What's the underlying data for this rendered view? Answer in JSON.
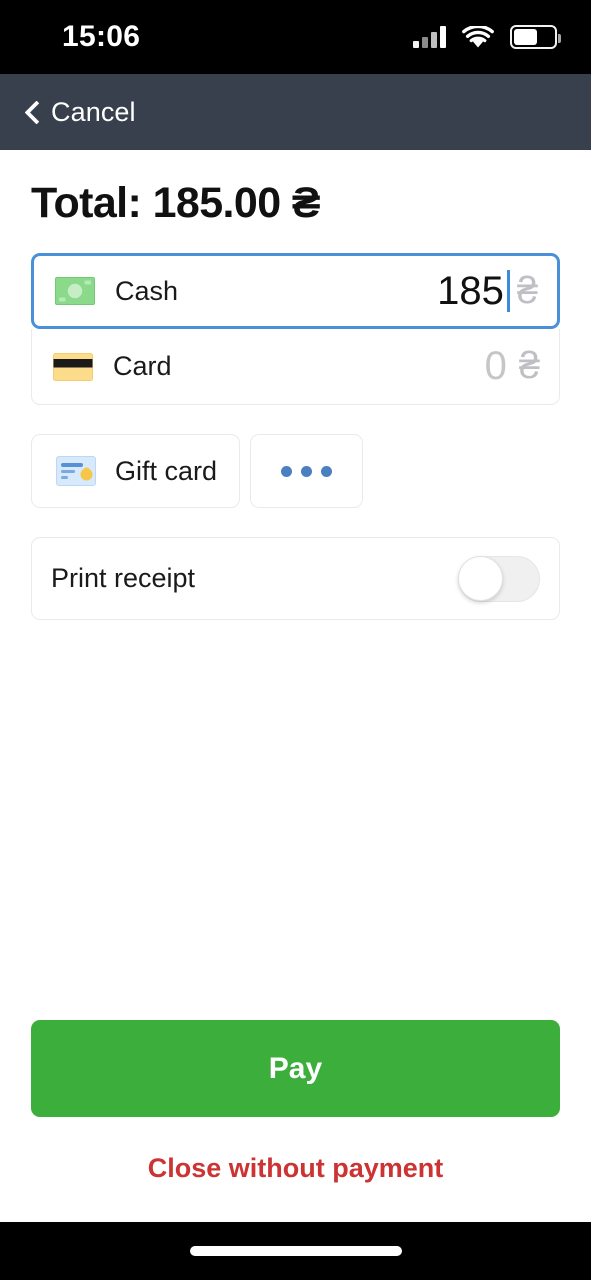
{
  "status_bar": {
    "time": "15:06",
    "signal_icon": "cellular-signal-icon",
    "wifi_icon": "wifi-icon",
    "battery_icon": "battery-icon",
    "battery_level_percent": 60
  },
  "nav_bar": {
    "back_icon": "chevron-left-icon",
    "back_label": "Cancel",
    "background_color": "#39404d"
  },
  "main": {
    "total_title": "Total: 185.00 ₴",
    "payment_methods": [
      {
        "icon": "cash-banknote-icon",
        "label": "Cash",
        "amount": "185",
        "currency": "₴",
        "focused": true,
        "has_cursor": true
      },
      {
        "icon": "credit-card-icon",
        "label": "Card",
        "amount": "0",
        "currency": "₴",
        "focused": false,
        "has_cursor": false
      }
    ],
    "secondary_buttons": [
      {
        "icon": "gift-card-icon",
        "label": "Gift card"
      },
      {
        "icon": "more-dots-icon",
        "label": "•••"
      }
    ],
    "settings": {
      "print_receipt_label": "Print receipt",
      "print_receipt_enabled": false
    }
  },
  "footer": {
    "pay_label": "Pay",
    "pay_color": "#3cae3c",
    "close_label": "Close without payment",
    "close_color": "#cc3333"
  }
}
